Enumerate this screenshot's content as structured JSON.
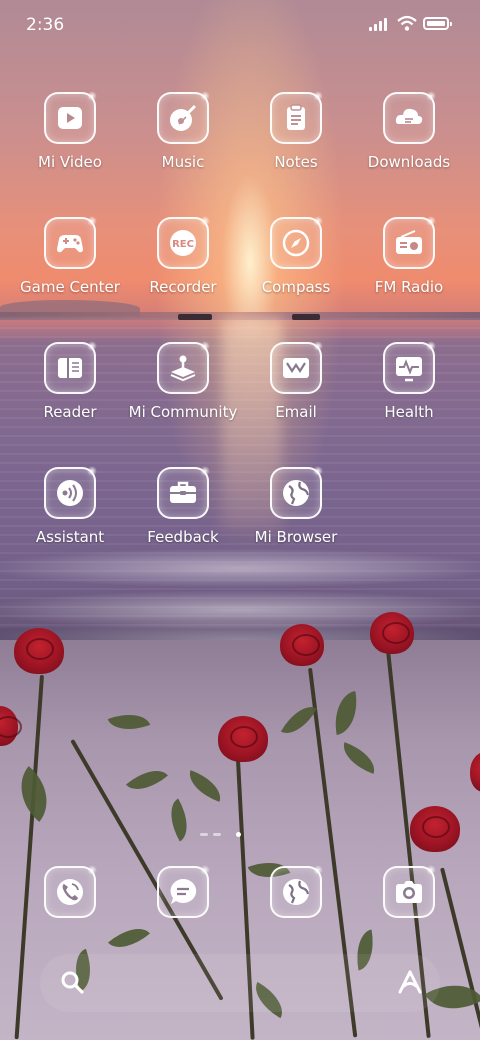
{
  "status_bar": {
    "time": "2:36"
  },
  "apps": [
    {
      "label": "Mi Video",
      "icon": "play-video-icon"
    },
    {
      "label": "Music",
      "icon": "guitar-music-icon"
    },
    {
      "label": "Notes",
      "icon": "notes-icon"
    },
    {
      "label": "Downloads",
      "icon": "download-cloud-icon"
    },
    {
      "label": "Game Center",
      "icon": "gamepad-icon"
    },
    {
      "label": "Recorder",
      "icon": "rec-icon",
      "badge": "REC"
    },
    {
      "label": "Compass",
      "icon": "compass-icon"
    },
    {
      "label": "FM Radio",
      "icon": "radio-icon"
    },
    {
      "label": "Reader",
      "icon": "book-icon"
    },
    {
      "label": "Mi Community",
      "icon": "community-icon"
    },
    {
      "label": "Email",
      "icon": "mail-icon"
    },
    {
      "label": "Health",
      "icon": "heart-monitor-icon"
    },
    {
      "label": "Assistant",
      "icon": "voice-assistant-icon"
    },
    {
      "label": "Feedback",
      "icon": "toolbox-icon"
    },
    {
      "label": "Mi Browser",
      "icon": "globe-icon"
    }
  ],
  "dock": [
    {
      "icon": "phone-icon"
    },
    {
      "icon": "message-icon"
    },
    {
      "icon": "browser-icon"
    },
    {
      "icon": "camera-icon"
    }
  ],
  "page_indicator": {
    "pages": 3,
    "current": 3
  },
  "colors": {
    "icon_stroke": "#ffffff",
    "label": "#ffffff"
  }
}
